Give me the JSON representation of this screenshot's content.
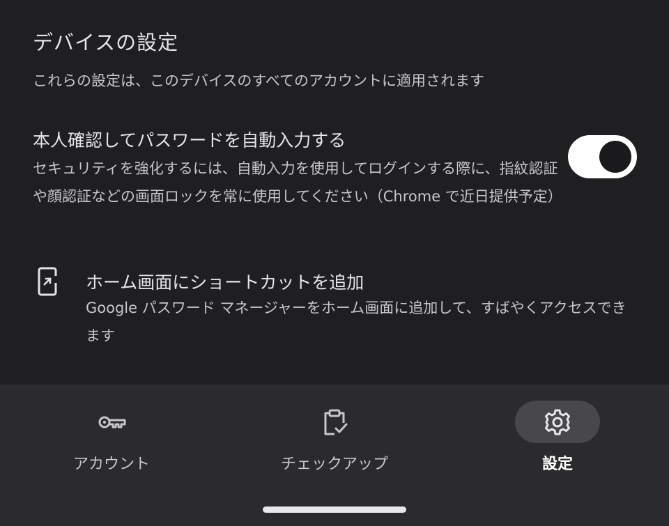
{
  "section": {
    "title": "デバイスの設定",
    "description": "これらの設定は、このデバイスのすべてのアカウントに適用されます"
  },
  "autofill_setting": {
    "title": "本人確認してパスワードを自動入力する",
    "description": "セキュリティを強化するには、自動入力を使用してログインする際に、指紋認証や顔認証などの画面ロックを常に使用してください（Chrome で近日提供予定）",
    "toggle_on": true
  },
  "shortcut": {
    "icon": "add-to-home-screen-icon",
    "title": "ホーム画面にショートカットを追加",
    "description": "Google パスワード マネージャーをホーム画面に追加して、すばやくアクセスできます"
  },
  "bottom_nav": {
    "items": [
      {
        "label": "アカウント",
        "icon": "key-icon",
        "active": false
      },
      {
        "label": "チェックアップ",
        "icon": "clipboard-check-icon",
        "active": false
      },
      {
        "label": "設定",
        "icon": "gear-icon",
        "active": true
      }
    ]
  },
  "colors": {
    "background": "#1f1f21",
    "nav_background": "#2b2b2d",
    "active_pill": "#48484b",
    "toggle_track": "#ffffff",
    "toggle_knob": "#1a1a1c"
  }
}
